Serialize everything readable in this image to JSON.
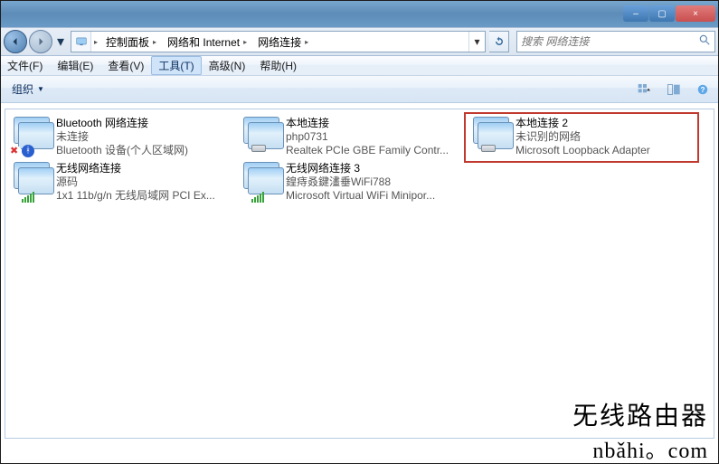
{
  "titlebar": {
    "minimize": "–",
    "maximize": "▢",
    "close": "×"
  },
  "address": {
    "crumbs": [
      "控制面板",
      "网络和 Internet",
      "网络连接"
    ],
    "search_placeholder": "搜索 网络连接"
  },
  "menubar": {
    "items": [
      {
        "label": "文件(F)"
      },
      {
        "label": "编辑(E)"
      },
      {
        "label": "查看(V)"
      },
      {
        "label": "工具(T)",
        "active": true
      },
      {
        "label": "高级(N)"
      },
      {
        "label": "帮助(H)"
      }
    ]
  },
  "cmdbar": {
    "organize": "组织"
  },
  "connections": [
    {
      "name": "Bluetooth 网络连接",
      "status": "未连接",
      "device": "Bluetooth 设备(个人区域网)",
      "icon": {
        "sub1": "red-x",
        "sub2": "bluetooth"
      }
    },
    {
      "name": "本地连接",
      "status": "php0731",
      "device": "Realtek PCIe GBE Family Contr...",
      "icon": {
        "sub2": "ethernet"
      }
    },
    {
      "name": "本地连接 2",
      "status": "未识别的网络",
      "device": "Microsoft Loopback Adapter",
      "icon": {
        "sub2": "ethernet"
      },
      "highlighted": true
    },
    {
      "name": "无线网络连接",
      "status": "源码",
      "device": "1x1 11b/g/n 无线局域网 PCI Ex...",
      "icon": {
        "sub2": "wifi"
      }
    },
    {
      "name": "无线网络连接 3",
      "status": "鍠痔叒鍵澅垂WiFi788",
      "device": "Microsoft Virtual WiFi Minipor...",
      "icon": {
        "sub2": "wifi"
      }
    }
  ],
  "watermark": {
    "line1": "旡线路由器",
    "line2": "nbǎhi。com"
  }
}
